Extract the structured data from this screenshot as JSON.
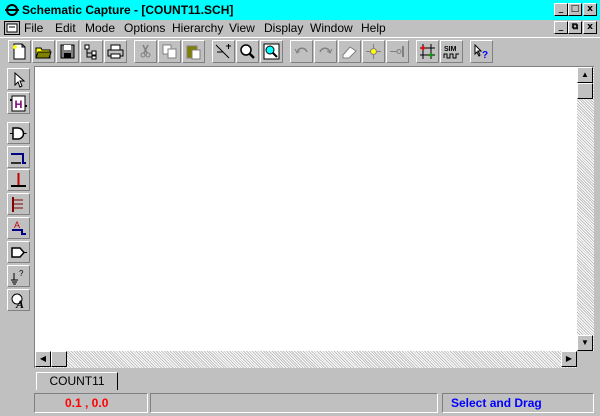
{
  "window": {
    "title": "Schematic Capture - [COUNT11.SCH]",
    "buttons": [
      "minimize-button",
      "restore-button",
      "close-button"
    ],
    "min_glyph": "_",
    "restore_glyph": "□",
    "close_glyph": "x",
    "child_min_glyph": "_",
    "child_restore_glyph": "⧉",
    "child_close_glyph": "x"
  },
  "menu": [
    {
      "label": "File"
    },
    {
      "label": "Edit"
    },
    {
      "label": "Mode"
    },
    {
      "label": "Options"
    },
    {
      "label": "Hierarchy"
    },
    {
      "label": "View"
    },
    {
      "label": "Display"
    },
    {
      "label": "Window"
    },
    {
      "label": "Help"
    }
  ],
  "toolbar": {
    "items": [
      "new-icon",
      "open-icon",
      "save-icon",
      "hierarchy-icon",
      "print-icon",
      "cut-icon",
      "copy-icon",
      "paste-icon",
      "add-wire-icon",
      "zoom-icon",
      "zoom-area-icon",
      "undo-icon",
      "redo-icon",
      "erase-icon",
      "junction-icon",
      "pin-icon",
      "netlist-icon",
      "sim-icon",
      "query-icon"
    ],
    "sim_label": "SIM"
  },
  "left_toolbar": {
    "items": [
      "select-arrow-icon",
      "hierarchy-block-icon",
      "and-gate-icon",
      "wire-icon",
      "ground-terminal-icon",
      "bus-icon",
      "label-icon",
      "buffer-icon",
      "power-icon",
      "text-icon"
    ],
    "hier_label": "H",
    "label_letter": "A",
    "text_letter": "A"
  },
  "tabs": [
    {
      "label": "COUNT11"
    }
  ],
  "status": {
    "coordinates": "0.1 ,   0.0",
    "message": "",
    "mode": "Select and Drag"
  },
  "colors": {
    "title_bg": "#00ffff",
    "face": "#c0c0c0",
    "coord_text": "#ff0000",
    "mode_text": "#0000ff"
  }
}
